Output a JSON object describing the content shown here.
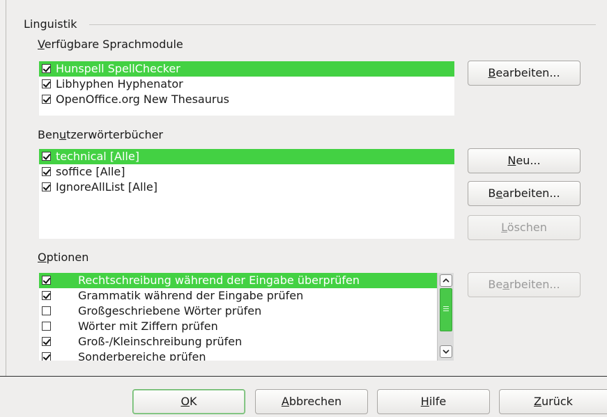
{
  "group": {
    "title": "Linguistik"
  },
  "modules": {
    "label_pre": "",
    "label_u": "V",
    "label_post": "erfügbare Sprachmodule",
    "items": [
      {
        "label": "Hunspell SpellChecker",
        "checked": true,
        "selected": true
      },
      {
        "label": "Libhyphen Hyphenator",
        "checked": true,
        "selected": false
      },
      {
        "label": "OpenOffice.org New Thesaurus",
        "checked": true,
        "selected": false
      }
    ],
    "edit_pre": "",
    "edit_u": "B",
    "edit_post": "earbeiten..."
  },
  "dictionaries": {
    "label_pre": "Ben",
    "label_u": "u",
    "label_post": "tzerwörterbücher",
    "items": [
      {
        "label": "technical [Alle]",
        "checked": true,
        "selected": true
      },
      {
        "label": "soffice [Alle]",
        "checked": true,
        "selected": false
      },
      {
        "label": "IgnoreAllList [Alle]",
        "checked": true,
        "selected": false
      }
    ],
    "new_pre": "",
    "new_u": "N",
    "new_post": "eu...",
    "edit_pre": "B",
    "edit_u": "e",
    "edit_post": "arbeiten...",
    "delete_pre": "",
    "delete_u": "L",
    "delete_post": "öschen"
  },
  "options": {
    "label_pre": "",
    "label_u": "O",
    "label_post": "ptionen",
    "items": [
      {
        "label": "Rechtschreibung während der Eingabe überprüfen",
        "checked": true,
        "selected": true
      },
      {
        "label": "Grammatik während der Eingabe prüfen",
        "checked": true,
        "selected": false
      },
      {
        "label": "Großgeschriebene Wörter prüfen",
        "checked": false,
        "selected": false
      },
      {
        "label": "Wörter mit Ziffern prüfen",
        "checked": false,
        "selected": false
      },
      {
        "label": "Groß-/Kleinschreibung prüfen",
        "checked": true,
        "selected": false
      },
      {
        "label": "Sonderbereiche prüfen",
        "checked": true,
        "selected": false
      }
    ],
    "edit_pre": "Be",
    "edit_u": "a",
    "edit_post": "rbeiten..."
  },
  "footer": {
    "ok_pre": "",
    "ok_u": "O",
    "ok_post": "K",
    "cancel_pre": "",
    "cancel_u": "A",
    "cancel_post": "bbrechen",
    "help_pre": "",
    "help_u": "H",
    "help_post": "ilfe",
    "back_pre": "",
    "back_u": "Z",
    "back_post": "urück"
  },
  "colors": {
    "selection": "#43d143",
    "accent_border": "#66b866"
  }
}
